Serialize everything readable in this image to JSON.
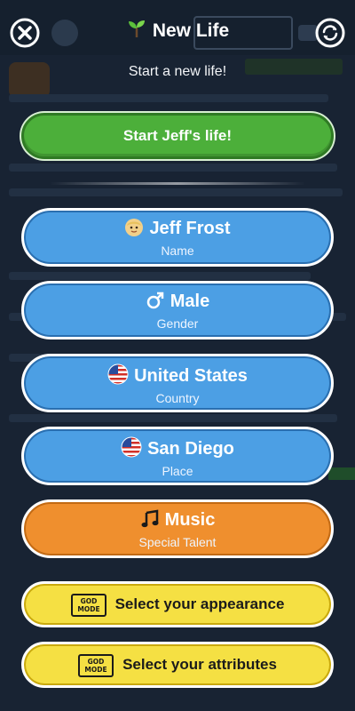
{
  "header": {
    "title": "New Life",
    "subtitle": "Start a new life!"
  },
  "start_button": {
    "label": "Start Jeff's life!"
  },
  "options": [
    {
      "key": "name",
      "value": "Jeff Frost",
      "caption": "Name",
      "icon": "baby-face-icon",
      "color": "#4c9fe4"
    },
    {
      "key": "gender",
      "value": "Male",
      "caption": "Gender",
      "icon": "male-symbol-icon",
      "color": "#4c9fe4"
    },
    {
      "key": "country",
      "value": "United States",
      "caption": "Country",
      "icon": "us-flag-icon",
      "color": "#4c9fe4"
    },
    {
      "key": "place",
      "value": "San Diego",
      "caption": "Place",
      "icon": "us-flag-icon",
      "color": "#4c9fe4"
    },
    {
      "key": "talent",
      "value": "Music",
      "caption": "Special Talent",
      "icon": "music-note-icon",
      "color": "#ef8f2e"
    }
  ],
  "god_mode": {
    "badge_text": "GOD MODE",
    "appearance_label": "Select your appearance",
    "attributes_label": "Select your attributes"
  },
  "colors": {
    "background": "#182333",
    "start_green": "#4caf3a",
    "option_blue": "#4c9fe4",
    "talent_orange": "#ef8f2e",
    "god_mode_yellow": "#f5e043"
  }
}
